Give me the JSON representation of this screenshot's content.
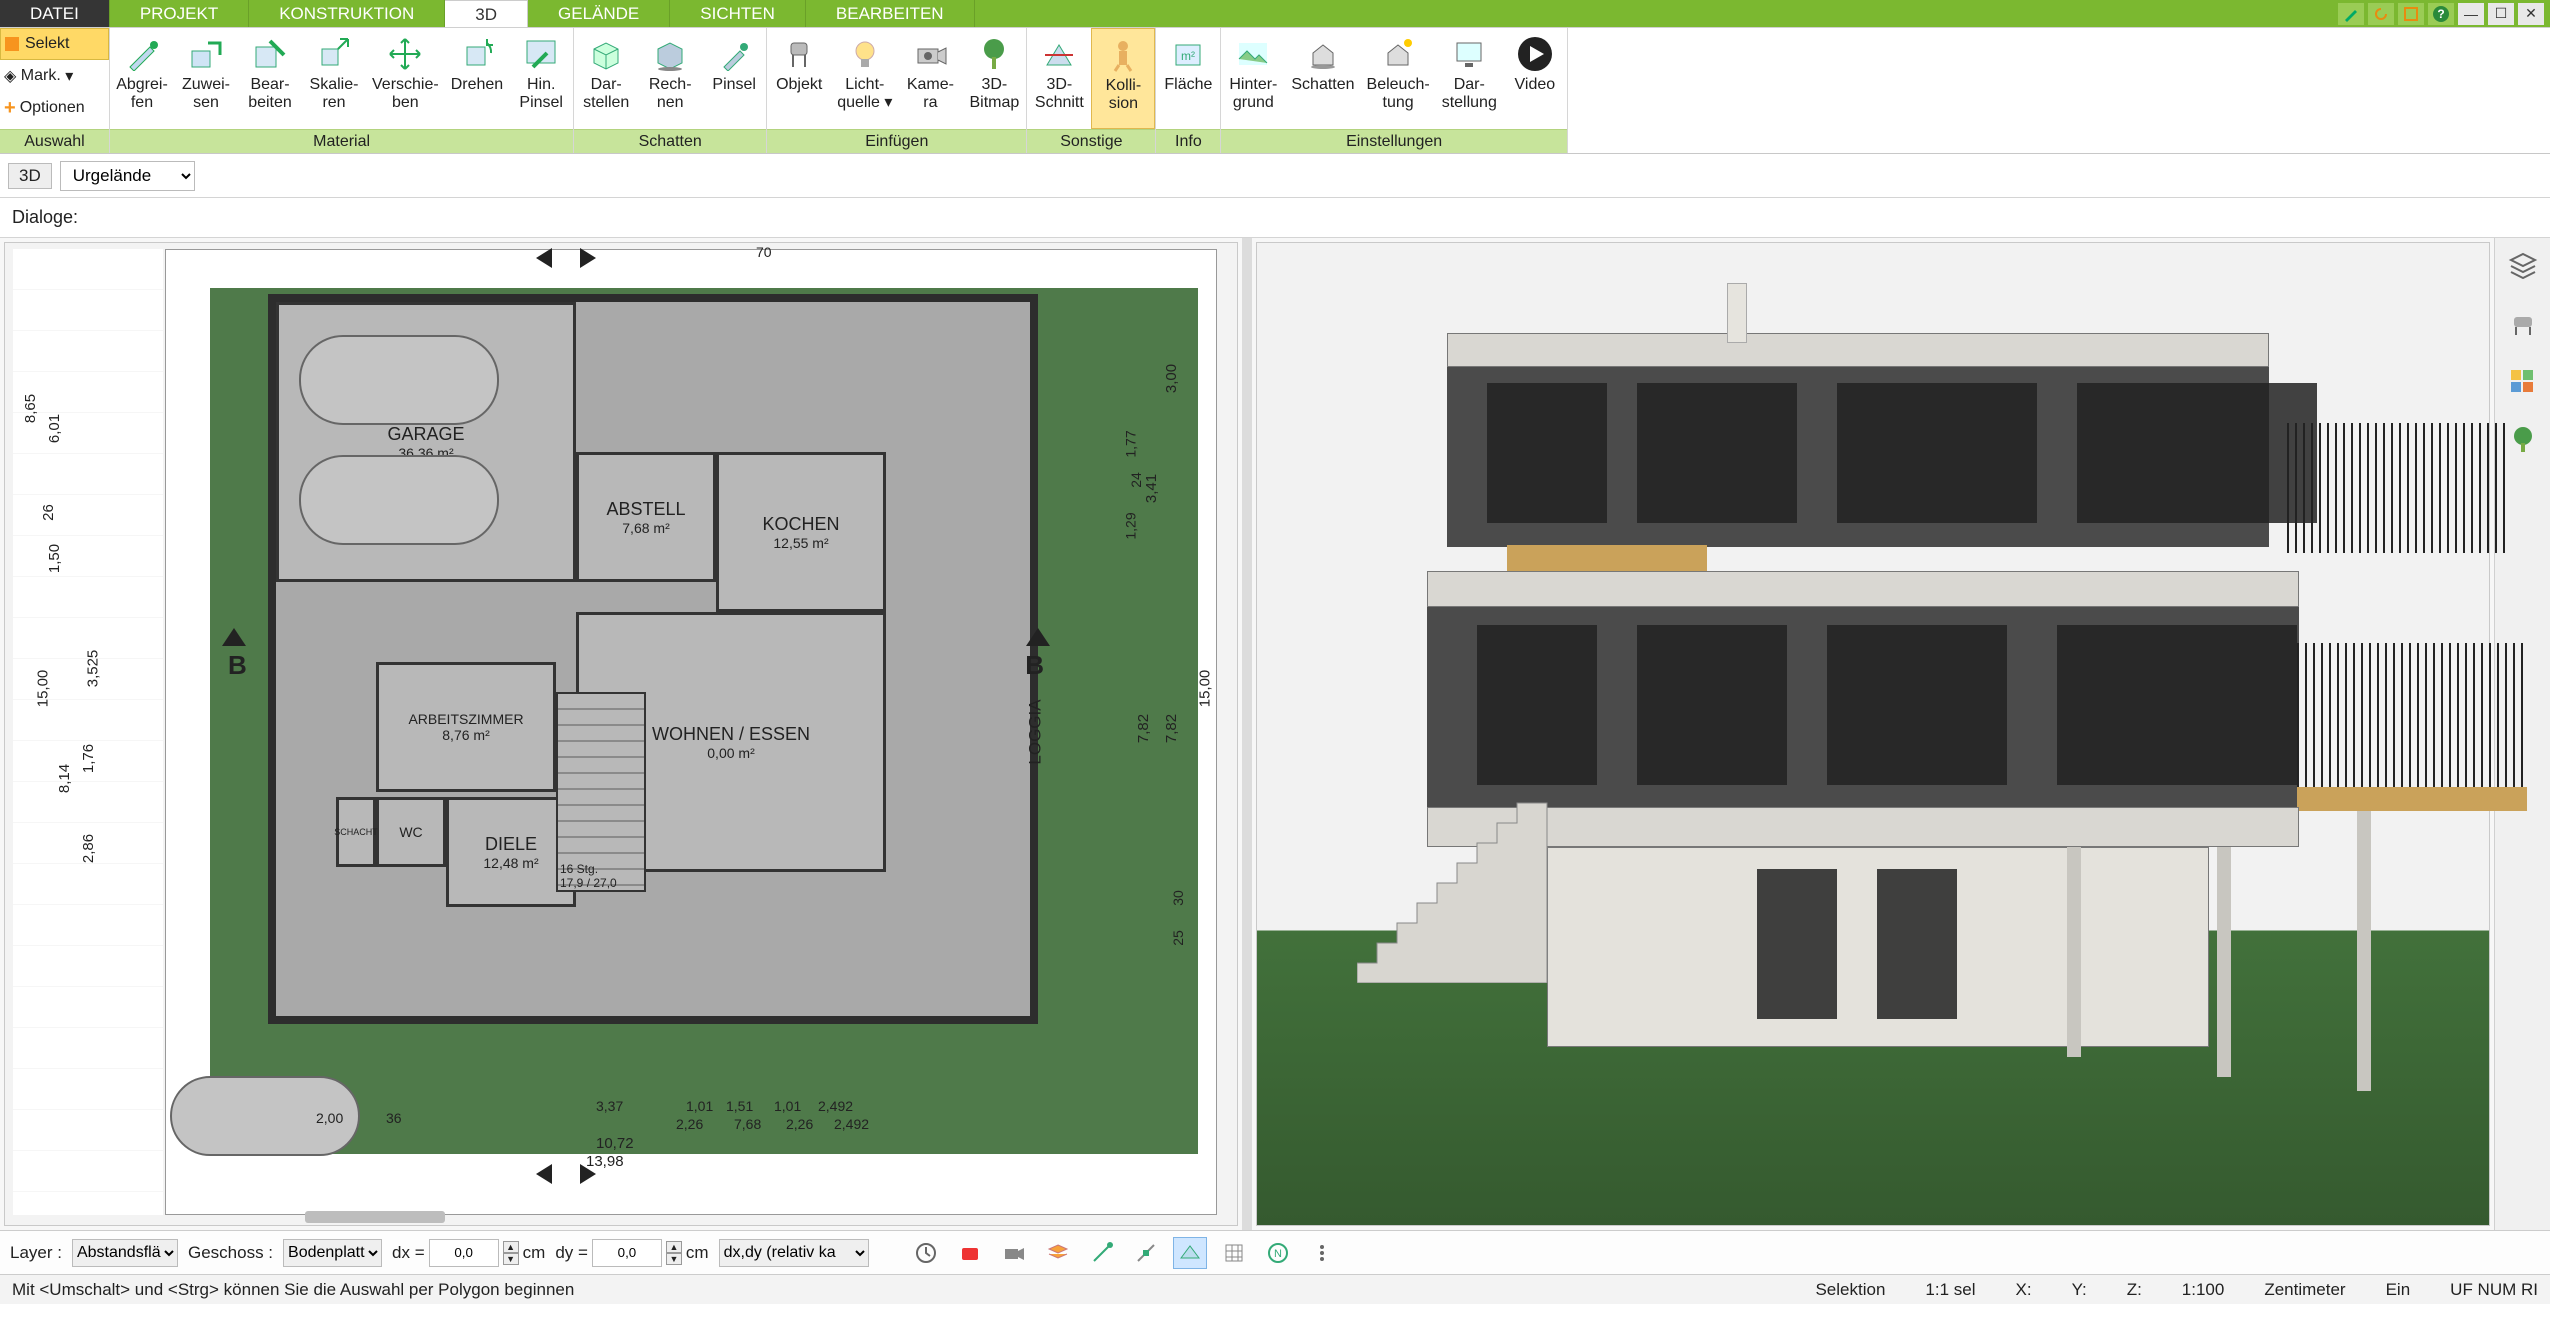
{
  "menu": {
    "tabs": [
      "DATEI",
      "PROJEKT",
      "KONSTRUKTION",
      "3D",
      "GELÄNDE",
      "SICHTEN",
      "BEARBEITEN"
    ],
    "active_index": 3
  },
  "ribbon_left": {
    "select": "Selekt",
    "mark": "Mark.",
    "options": "Optionen",
    "label": "Auswahl"
  },
  "ribbon_groups": [
    {
      "label": "Material",
      "tools": [
        {
          "id": "abgreifen",
          "line1": "Abgrei-",
          "line2": "fen"
        },
        {
          "id": "zuweisen",
          "line1": "Zuwei-",
          "line2": "sen"
        },
        {
          "id": "bearbeiten",
          "line1": "Bear-",
          "line2": "beiten"
        },
        {
          "id": "skalieren",
          "line1": "Skalie-",
          "line2": "ren"
        },
        {
          "id": "verschieben",
          "line1": "Verschie-",
          "line2": "ben"
        },
        {
          "id": "drehen",
          "line1": "Drehen",
          "line2": ""
        },
        {
          "id": "hin-pinsel",
          "line1": "Hin.",
          "line2": "Pinsel"
        }
      ]
    },
    {
      "label": "Schatten",
      "tools": [
        {
          "id": "darstellen",
          "line1": "Dar-",
          "line2": "stellen"
        },
        {
          "id": "rechnen",
          "line1": "Rech-",
          "line2": "nen"
        },
        {
          "id": "pinsel",
          "line1": "Pinsel",
          "line2": ""
        }
      ]
    },
    {
      "label": "Einfügen",
      "tools": [
        {
          "id": "objekt",
          "line1": "Objekt",
          "line2": ""
        },
        {
          "id": "lichtquelle",
          "line1": "Licht-",
          "line2": "quelle ▾"
        },
        {
          "id": "kamera",
          "line1": "Kame-",
          "line2": "ra"
        },
        {
          "id": "3d-bitmap",
          "line1": "3D-",
          "line2": "Bitmap"
        }
      ]
    },
    {
      "label": "Sonstige",
      "tools": [
        {
          "id": "3d-schnitt",
          "line1": "3D-",
          "line2": "Schnitt"
        },
        {
          "id": "kollision",
          "line1": "Kolli-",
          "line2": "sion",
          "active": true
        }
      ]
    },
    {
      "label": "Info",
      "tools": [
        {
          "id": "flaeche",
          "line1": "Fläche",
          "line2": ""
        }
      ]
    },
    {
      "label": "Einstellungen",
      "tools": [
        {
          "id": "hintergrund",
          "line1": "Hinter-",
          "line2": "grund"
        },
        {
          "id": "schatten2",
          "line1": "Schatten",
          "line2": ""
        },
        {
          "id": "beleuchtung",
          "line1": "Beleuch-",
          "line2": "tung"
        },
        {
          "id": "darstellung",
          "line1": "Dar-",
          "line2": "stellung"
        },
        {
          "id": "video",
          "line1": "Video",
          "line2": ""
        }
      ]
    }
  ],
  "subbar": {
    "tag": "3D",
    "select_value": "Urgelände"
  },
  "dialoge": {
    "label": "Dialoge:"
  },
  "floorplan": {
    "rooms": {
      "garage": {
        "name": "GARAGE",
        "area": "36,36 m²"
      },
      "abstell": {
        "name": "ABSTELL",
        "area": "7,68 m²"
      },
      "kochen": {
        "name": "KOCHEN",
        "area": "12,55 m²"
      },
      "arbeit": {
        "name": "ARBEITSZIMMER",
        "area": "8,76 m²"
      },
      "wohnen": {
        "name": "WOHNEN / ESSEN",
        "area": "0,00 m²"
      },
      "wc": {
        "name": "WC",
        "area": ""
      },
      "diele": {
        "name": "DIELE",
        "area": "12,48 m²"
      },
      "loggia": {
        "name": "LOGGIA",
        "area": ""
      },
      "schacht": {
        "name": "SCHACHT",
        "area": ""
      }
    },
    "section_marks": {
      "b_left": "B",
      "b_right": "B"
    },
    "stair_note": "16 Stg.\n17,9 / 27,0",
    "dims": {
      "left_total": "15,00",
      "left_mid": "8,14",
      "left_a": "3,525",
      "left_b": "1,76",
      "left_c": "2,86",
      "left_outer_a": "8,65",
      "left_outer_b": "6,01",
      "left_outer_c": "26",
      "left_outer_d": "1,50",
      "right_total": "15,00",
      "right_a": "3,00",
      "right_b": "3,41",
      "right_c": "7,82",
      "right_d": "7,82",
      "right_e": "1,77",
      "right_f": "24",
      "right_g": "1,29",
      "right_h": "30",
      "right_i": "25",
      "top": "70",
      "bot_a": "2,00",
      "bot_b": "36",
      "bot_c": "3,37",
      "bot_d": "1,01",
      "bot_e": "1,51",
      "bot_f": "1,01",
      "bot_g": "2,492",
      "bot_h": "2,26",
      "bot_i": "7,68",
      "bot_j": "2,26",
      "bot_k": "2,492",
      "bot_total": "13,98",
      "bot_mid": "10,72"
    }
  },
  "footer1": {
    "layer_label": "Layer :",
    "layer_value": "Abstandsflä",
    "geschoss_label": "Geschoss :",
    "geschoss_value": "Bodenplatt",
    "dx_label": "dx =",
    "dx_value": "0,0",
    "dx_unit": "cm",
    "dy_label": "dy =",
    "dy_value": "0,0",
    "dy_unit": "cm",
    "mode_value": "dx,dy (relativ ka"
  },
  "footer2": {
    "hint": "Mit <Umschalt> und <Strg> können Sie die Auswahl per Polygon beginnen",
    "selection": "Selektion",
    "sel_count": "1:1 sel",
    "x_label": "X:",
    "y_label": "Y:",
    "z_label": "Z:",
    "scale": "1:100",
    "unit": "Zentimeter",
    "ins": "Ein",
    "state": "UF  NUM  RI"
  }
}
